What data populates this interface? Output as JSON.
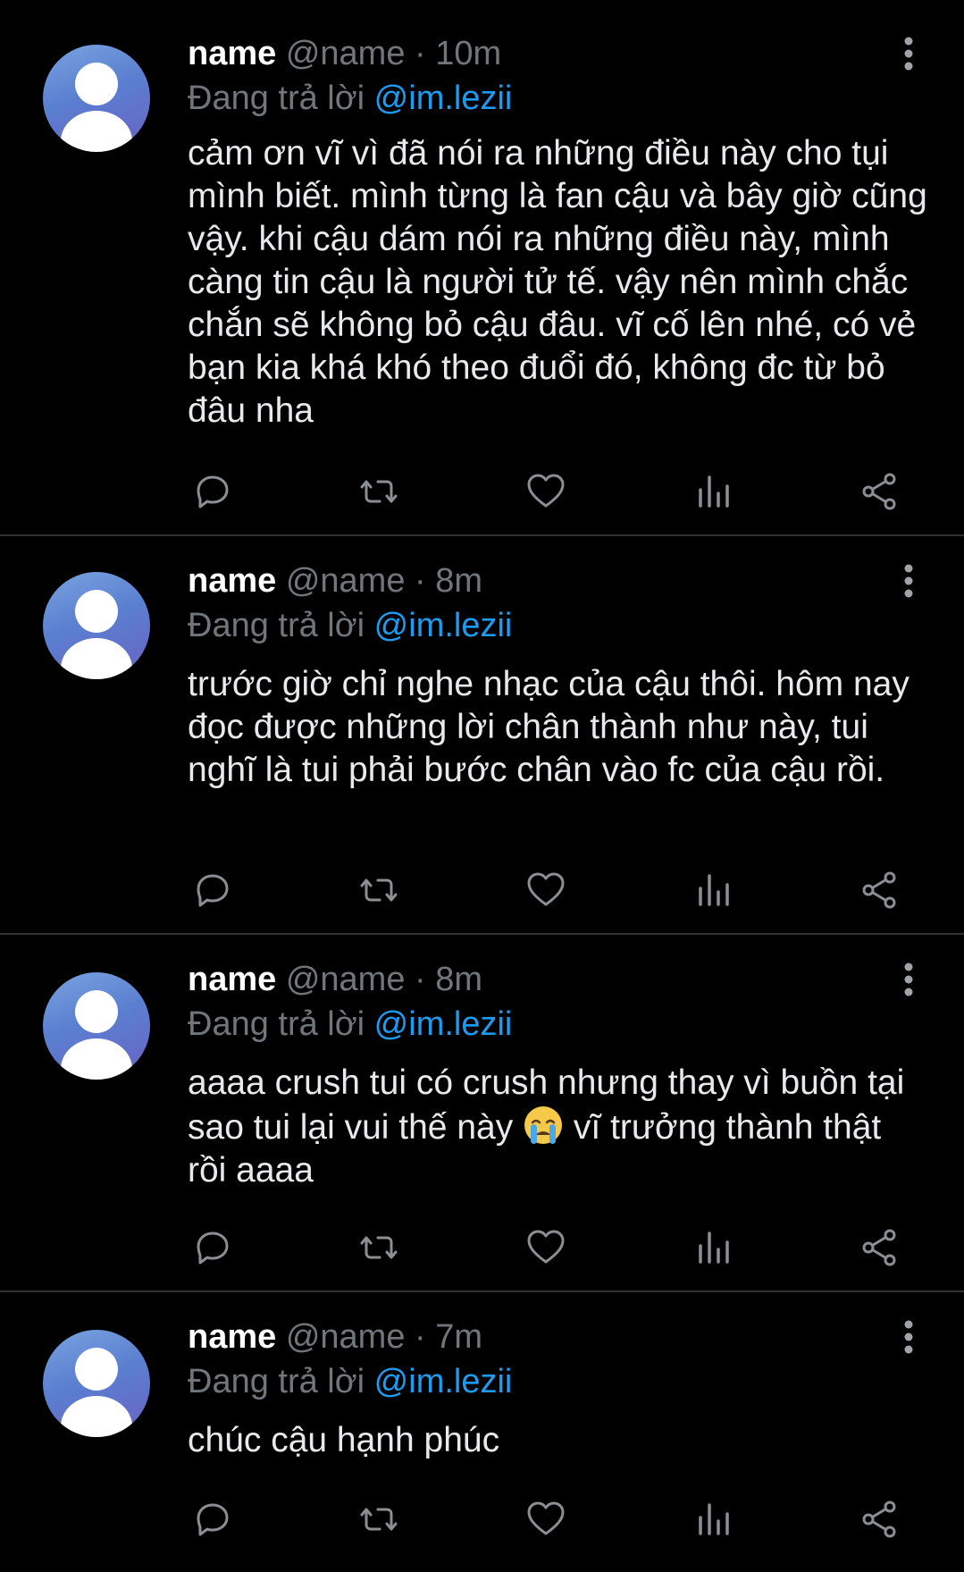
{
  "tweets": [
    {
      "name": "name",
      "handle": "@name",
      "separator": "·",
      "time": "10m",
      "reply_prefix": "Đang trả lời",
      "reply_to": "@im.lezii",
      "text": "cảm ơn vĩ vì đã nói ra những điều này cho tụi mình biết. mình từng là fan cậu và bây giờ cũng vậy. khi cậu dám nói ra những điều này, mình càng tin cậu là người tử tế. vậy nên mình chắc chắn sẽ không bỏ cậu đâu. vĩ cố lên nhé, có vẻ bạn kia khá khó theo đuổi đó, không đc từ bỏ đâu nha"
    },
    {
      "name": "name",
      "handle": "@name",
      "separator": "·",
      "time": "8m",
      "reply_prefix": "Đang trả lời",
      "reply_to": "@im.lezii",
      "text": "trước giờ chỉ nghe nhạc của cậu thôi. hôm nay đọc được những lời chân thành như này, tui nghĩ là tui phải bước chân vào fc của cậu rồi."
    },
    {
      "name": "name",
      "handle": "@name",
      "separator": "·",
      "time": "8m",
      "reply_prefix": "Đang trả lời",
      "reply_to": "@im.lezii",
      "text_before_emoji": "aaaa crush tui có crush nhưng thay vì buồn tại sao tui lại vui thế này ",
      "emoji": "loudly-crying-face-emoji",
      "text_after_emoji": " vĩ trưởng thành thật rồi aaaa"
    },
    {
      "name": "name",
      "handle": "@name",
      "separator": "·",
      "time": "7m",
      "reply_prefix": "Đang trả lời",
      "reply_to": "@im.lezii",
      "text": "chúc cậu hạnh phúc"
    }
  ],
  "icons": {
    "reply": "reply-icon",
    "retweet": "retweet-icon",
    "like": "heart-icon",
    "views": "analytics-icon",
    "share": "share-icon",
    "more": "more-vertical-icon",
    "avatar": "default-avatar"
  },
  "colors": {
    "background": "#000000",
    "text": "#e7e9ea",
    "muted": "#71767b",
    "mention": "#1d9bf0",
    "divider": "#2f3336"
  }
}
